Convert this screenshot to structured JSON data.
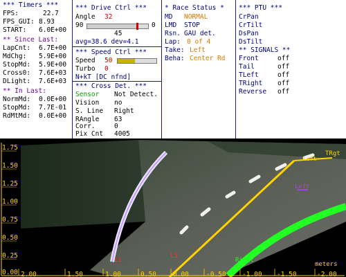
{
  "timers": {
    "title": "*** Timers ***",
    "fps_label": "FPS:",
    "fps_value": "22.7",
    "fps_gui_label": "FPS_GUI:",
    "fps_gui_value": "8.93",
    "start_label": "START:",
    "start_value": "6.0E+00",
    "since_last_title": "** Since Last:",
    "lapcnt_label": "LapCnt:",
    "lapcnt_value": "6.7E+00",
    "mdchg_label": "MdChg:",
    "mdchg_value": "5.9E+00",
    "stopmd_label": "StopMd:",
    "stopmd_value": "5.9E+00",
    "cross0_label": "Cross0:",
    "cross0_value": "7.6E+03",
    "dlight_label": "DLight:",
    "dlight_value": "7.6E+03",
    "in_last_title": "** In Last:",
    "normmd_label": "NormMd:",
    "normmd_value": "0.0E+00",
    "stopmd2_label": "StopMd:",
    "stopmd2_value": "7.7E-01",
    "rdmtmd_label": "RdMtMd:",
    "rdmtmd_value": "0.0E+00"
  },
  "drive": {
    "title": "***  Drive Ctrl  ***",
    "angle_label": "Angle",
    "angle_value": "32",
    "slider_min": "90",
    "slider_max": "0",
    "slider_mid": "45",
    "slider_level": 0.82,
    "avg_text": "avg=38.6  dev=4.1",
    "speed_title": "***  Speed Ctrl  ***",
    "speed_label": "Speed",
    "speed_value": "50",
    "speed_level": 0.45,
    "turbo_label": "Turbo",
    "turbo_value": "0",
    "nkt_text": "N+kT [DC nfnd]",
    "cross_title": "*** Cross Det. ***",
    "sensor_label": "Sensor",
    "sensor_value": "Not Detect.",
    "vision_label": "Vision",
    "vision_value": "no",
    "sline_label": "S. Line",
    "sline_value": "Right",
    "rangle_label": "RAngle",
    "rangle_value": "63",
    "corr_label": "Corr.",
    "corr_value": "0",
    "pixcnt_label": "Pix Cnt",
    "pixcnt_value": "4005"
  },
  "race": {
    "title": "* Race Status *",
    "md_label": "MD",
    "md_value": "NORMAL",
    "lmd_label": "LMD",
    "lmd_value": "STOP",
    "rsn_label": "Rsn.",
    "rsn_value": "GAU det.",
    "lap_label": "Lap:",
    "lap_value": "0 of 4",
    "take_label": "Take:",
    "take_value": "Left",
    "beha_label": "Beha:",
    "beha_value": "Center Rd"
  },
  "ptu": {
    "title": "*** PTU ***",
    "items": [
      "CrPan",
      "CrTilt",
      "DsPan",
      "DsTilt"
    ],
    "signals_title": "** SIGNALS **",
    "signals": [
      {
        "label": "Front",
        "value": "off"
      },
      {
        "label": "Tail",
        "value": "off"
      },
      {
        "label": "TLeft",
        "value": "off"
      },
      {
        "label": "TRight",
        "value": "off"
      },
      {
        "label": "Reverse",
        "value": "off"
      }
    ]
  },
  "camera": {
    "y_ticks": [
      "1.75",
      "1.50",
      "1.25",
      "1.00",
      "0.75",
      "0.50",
      "0.25",
      "0.00"
    ],
    "x_ticks": [
      "2.00",
      "1.50",
      "1.00",
      "0.50",
      "0.00",
      "-0.50",
      "-1.00",
      "-1.50",
      "-2.00"
    ],
    "units_label": "meters",
    "markers": {
      "l1": "L1",
      "l5": "L5",
      "right": "Right",
      "purple": "Left",
      "tright": "TRgt",
      "yellow_top": "Left"
    }
  },
  "colors": {
    "panel_text": "#00007a",
    "red": "#d00000",
    "orange": "#d87a00",
    "green": "#00a000",
    "axis_yellow": "#ffd400",
    "track_green": "#22ff22",
    "purple": "#8a2be2"
  }
}
